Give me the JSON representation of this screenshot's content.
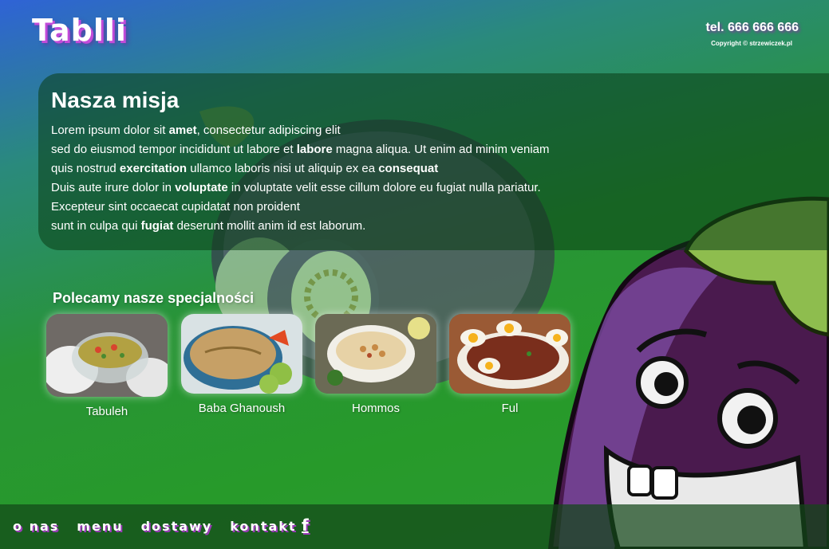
{
  "brand": {
    "logo_text": "Tablli"
  },
  "header": {
    "phone": "tel. 666 666 666",
    "copyright": "Copyright © strzewiczek.pl"
  },
  "mission": {
    "title": "Nasza misja",
    "lines": [
      [
        {
          "t": "Lorem ipsum dolor sit "
        },
        {
          "b": "amet"
        },
        {
          "t": ", consectetur adipiscing elit"
        }
      ],
      [
        {
          "t": "sed do eiusmod tempor incididunt ut labore et "
        },
        {
          "b": "labore"
        },
        {
          "t": " magna aliqua. Ut enim ad minim veniam"
        }
      ],
      [
        {
          "t": "quis nostrud "
        },
        {
          "b": "exercitation"
        },
        {
          "t": " ullamco laboris nisi ut aliquip ex ea "
        },
        {
          "b": "consequat"
        }
      ],
      [
        {
          "t": "Duis aute irure dolor in "
        },
        {
          "b": "voluptate"
        },
        {
          "t": " in voluptate velit esse cillum dolore eu fugiat nulla pariatur."
        }
      ],
      [
        {
          "t": "Excepteur sint occaecat cupidatat non proident"
        }
      ],
      [
        {
          "t": "sunt in culpa qui "
        },
        {
          "b": "fugiat"
        },
        {
          "t": " deserunt mollit anim id est laborum."
        }
      ]
    ]
  },
  "specials": {
    "title": "Polecamy nasze specjalności",
    "items": [
      {
        "name": "Tabuleh"
      },
      {
        "name": "Baba Ghanoush"
      },
      {
        "name": "Hommos"
      },
      {
        "name": "Ful"
      }
    ]
  },
  "footer": {
    "nav": [
      "o nas",
      "menu",
      "dostawy",
      "kontakt"
    ],
    "facebook_icon": "f"
  },
  "colors": {
    "gradient_top": "#2f63d6",
    "gradient_bottom": "#279a2a",
    "logo_shadow": "#c24bd9",
    "eggplant": "#4a2a5e"
  }
}
